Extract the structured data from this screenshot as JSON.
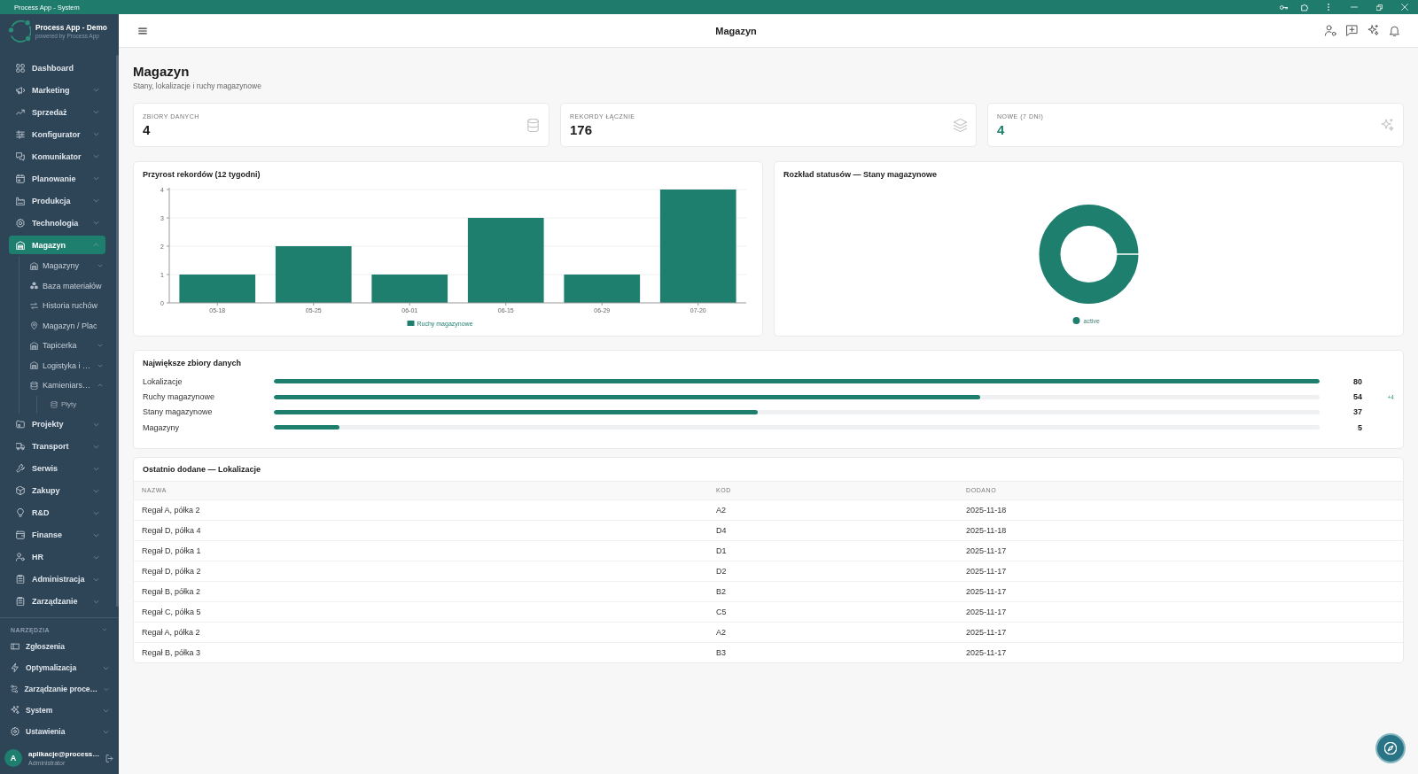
{
  "window": {
    "title": "Process App - System"
  },
  "sidebar": {
    "brand": {
      "name": "Process App - Demo",
      "tagline": "powered by Process App"
    },
    "items": [
      {
        "label": "Dashboard",
        "selected": false
      },
      {
        "label": "Marketing",
        "selected": false,
        "expanded": false
      },
      {
        "label": "Sprzedaż",
        "selected": false,
        "expanded": false
      },
      {
        "label": "Konfigurator",
        "selected": false,
        "expanded": false
      },
      {
        "label": "Komunikator",
        "selected": false,
        "expanded": false
      },
      {
        "label": "Planowanie",
        "selected": false,
        "expanded": false
      },
      {
        "label": "Produkcja",
        "selected": false,
        "expanded": false
      },
      {
        "label": "Technologia",
        "selected": false,
        "expanded": false
      },
      {
        "label": "Magazyn",
        "selected": true,
        "expanded": true,
        "children": [
          {
            "label": "Magazyny",
            "selected": false,
            "expanded": false
          },
          {
            "label": "Baza materiałów",
            "selected": false
          },
          {
            "label": "Historia ruchów",
            "selected": false
          },
          {
            "label": "Magazyn / Plac",
            "selected": false
          },
          {
            "label": "Tapicerka",
            "selected": false,
            "expanded": false
          },
          {
            "label": "Logistyka i …",
            "selected": false,
            "expanded": false
          },
          {
            "label": "Kamieniars…",
            "selected": false,
            "expanded": true,
            "children": [
              {
                "label": "Płyty",
                "selected": false
              }
            ]
          }
        ]
      },
      {
        "label": "Projekty",
        "selected": false,
        "expanded": false
      },
      {
        "label": "Transport",
        "selected": false,
        "expanded": false
      },
      {
        "label": "Serwis",
        "selected": false,
        "expanded": false
      },
      {
        "label": "Zakupy",
        "selected": false,
        "expanded": false
      },
      {
        "label": "R&D",
        "selected": false,
        "expanded": false
      },
      {
        "label": "Finanse",
        "selected": false,
        "expanded": false
      },
      {
        "label": "HR",
        "selected": false,
        "expanded": false
      },
      {
        "label": "Administracja",
        "selected": false,
        "expanded": false
      },
      {
        "label": "Zarządzanie",
        "selected": false,
        "expanded": false
      }
    ],
    "tools": {
      "heading": "NARZĘDZIA",
      "expanded": true,
      "items": [
        {
          "label": "Zgłoszenia",
          "selected": false
        },
        {
          "label": "Optymalizacja",
          "selected": false,
          "expanded": false
        },
        {
          "label": "Zarządzanie proce…",
          "selected": false,
          "expanded": false
        },
        {
          "label": "System",
          "selected": false,
          "expanded": false
        },
        {
          "label": "Ustawienia",
          "selected": false,
          "expanded": false
        }
      ]
    },
    "user": {
      "avatar": "A",
      "name": "aplikacje@process…",
      "role": "Administrator"
    }
  },
  "header": {
    "title": "Magazyn"
  },
  "page": {
    "title": "Magazyn",
    "subtitle": "Stany, lokalizacje i ruchy magazynowe"
  },
  "stats": [
    {
      "kind": "datasets",
      "label": "ZBIORY DANYCH",
      "value": "4"
    },
    {
      "kind": "records",
      "label": "REKORDY ŁĄCZNIE",
      "value": "176"
    },
    {
      "kind": "new",
      "label": "NOWE (7 DNI)",
      "value": "4"
    }
  ],
  "growth_chart": {
    "title": "Przyrost rekordów (12 tygodni)",
    "chart_data": {
      "type": "bar",
      "categories": [
        "05-18",
        "05-25",
        "06-01",
        "06-15",
        "06-29",
        "07-20"
      ],
      "series": [
        {
          "name": "Ruchy magazynowe",
          "color": "#1f7f6f",
          "values": [
            1,
            2,
            1,
            3,
            1,
            4
          ]
        }
      ],
      "ylim": [
        0,
        4
      ],
      "yticks": [
        0,
        1,
        2,
        3,
        4
      ],
      "grid": true
    }
  },
  "status_chart": {
    "title": "Rozkład statusów — Stany magazynowe",
    "legend": [
      "active"
    ]
  },
  "largest_datasets": {
    "title": "Największe zbiory danych",
    "items": [
      {
        "label": "Lokalizacje",
        "level": 1,
        "value": "80"
      },
      {
        "label": "Ruchy magazynowe",
        "level": 0.675,
        "value": "54",
        "delta": "+4"
      },
      {
        "label": "Stany magazynowe",
        "level": 0.4625,
        "value": "37"
      },
      {
        "label": "Magazyny",
        "level": 0.0625,
        "value": "5"
      }
    ]
  },
  "recent": {
    "title": "Ostatnio dodane — Lokalizacje",
    "columns": [
      "NAZWA",
      "KOD",
      "DODANO"
    ],
    "rows": [
      [
        "Regał A, półka 2",
        "A2",
        "2025-11-18"
      ],
      [
        "Regał D, półka 4",
        "D4",
        "2025-11-18"
      ],
      [
        "Regał D, półka 1",
        "D1",
        "2025-11-17"
      ],
      [
        "Regał D, półka 2",
        "D2",
        "2025-11-17"
      ],
      [
        "Regał B, półka 2",
        "B2",
        "2025-11-17"
      ],
      [
        "Regał C, półka 5",
        "C5",
        "2025-11-17"
      ],
      [
        "Regał A, półka 2",
        "A2",
        "2025-11-17"
      ],
      [
        "Regał B, półka 3",
        "B3",
        "2025-11-17"
      ]
    ]
  }
}
